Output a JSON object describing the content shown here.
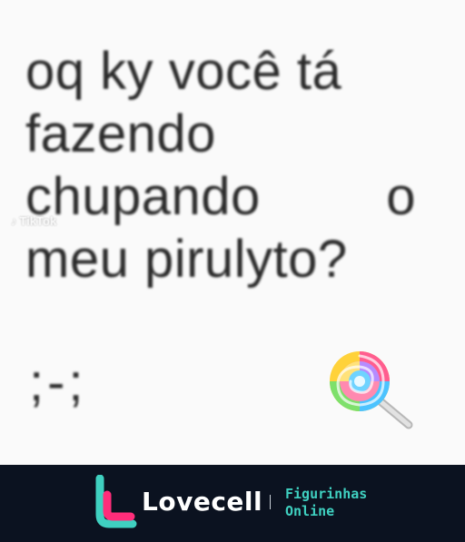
{
  "sticker": {
    "lines": [
      "oq ky você tá",
      "fazendo",
      "chupando",
      "o",
      "meu pirulyto?"
    ],
    "emoticon": ";-;",
    "watermark": {
      "brand": "TikTok"
    },
    "emoji": "lollipop-icon"
  },
  "footer": {
    "brand_name": "Lovecell",
    "tagline_line1": "Figurinhas",
    "tagline_line2": "Online",
    "colors": {
      "background": "#0b1220",
      "tagline": "#3fd0c0",
      "logo_pink": "#ff2d7a",
      "logo_teal": "#3fd0c0"
    }
  }
}
